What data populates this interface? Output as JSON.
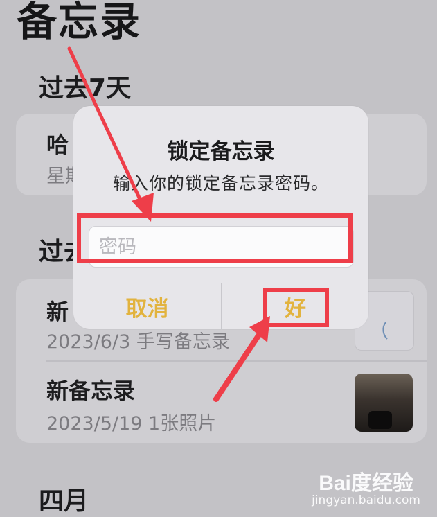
{
  "header": {
    "title": "备忘录"
  },
  "sections": {
    "last7": {
      "label": "过去7天"
    },
    "past30_partial": {
      "label": "过去"
    },
    "april": {
      "label": "四月"
    }
  },
  "notes": [
    {
      "title_partial": "哈",
      "meta_partial": "星期"
    },
    {
      "title_partial": "新",
      "meta": "2023/6/3  手写备忘录"
    },
    {
      "title": "新备忘录",
      "meta": "2023/5/19  1张照片"
    }
  ],
  "dialog": {
    "title": "锁定备忘录",
    "message": "输入你的锁定备忘录密码。",
    "password_placeholder": "密码",
    "password_value": "",
    "cancel_label": "取消",
    "ok_label": "好"
  },
  "watermark": {
    "logo": "Bai度经验",
    "url": "jingyan.baidu.com"
  },
  "colors": {
    "accent": "#e2b33e",
    "annotation": "#ee3e49"
  }
}
